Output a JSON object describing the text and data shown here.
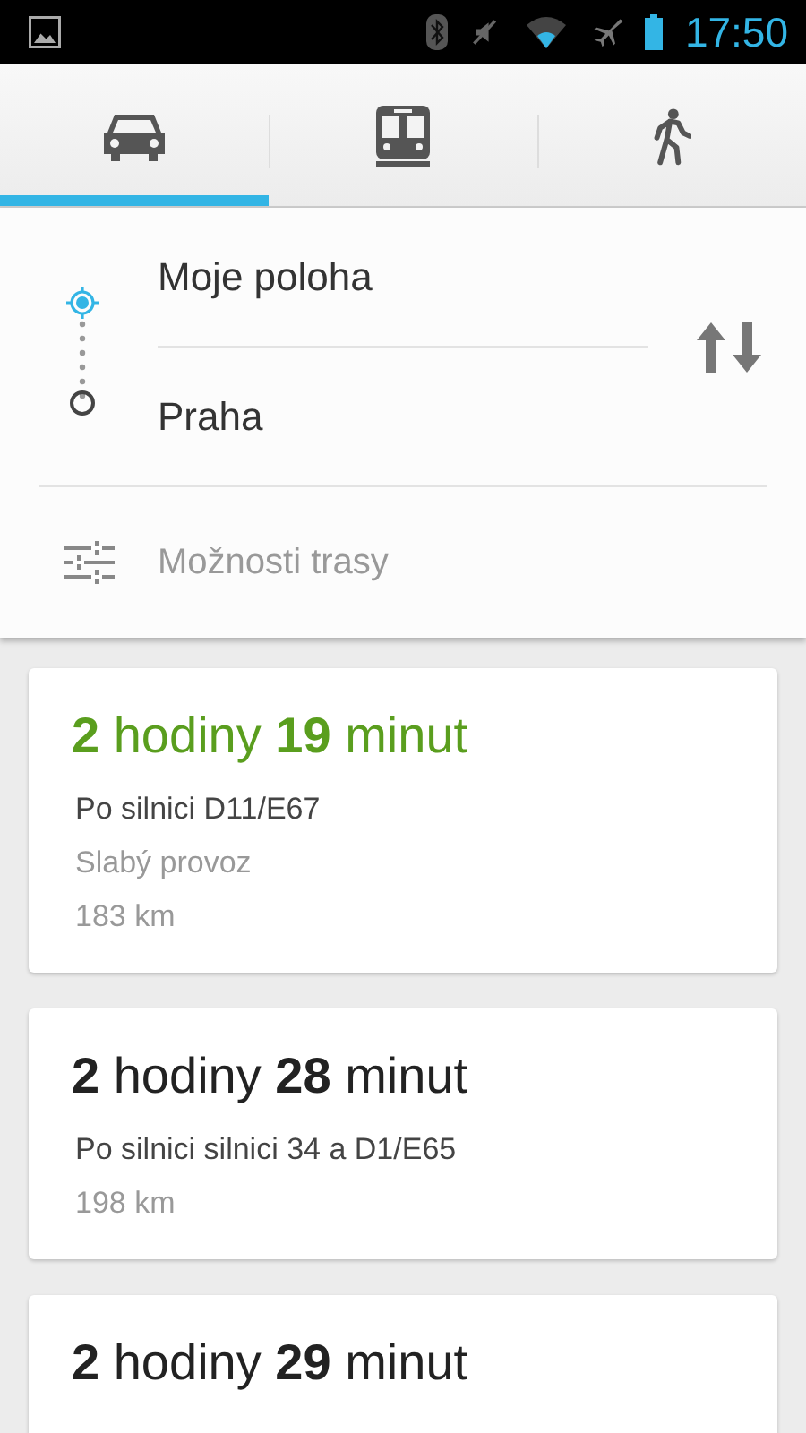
{
  "status_bar": {
    "time": "17:50"
  },
  "tabs": [
    {
      "kind": "car",
      "selected": true
    },
    {
      "kind": "transit",
      "selected": false
    },
    {
      "kind": "walk",
      "selected": false
    }
  ],
  "route_form": {
    "origin": "Moje poloha",
    "destination": "Praha",
    "options_label": "Možnosti trasy"
  },
  "routes": [
    {
      "duration": "**2** hodiny **19** minut",
      "highlighted": true,
      "details": [
        {
          "kind": "via",
          "text": "Po silnici D11/E67"
        },
        {
          "kind": "traffic",
          "text": "Slabý provoz"
        },
        {
          "kind": "distance",
          "text": "183 km"
        }
      ]
    },
    {
      "duration": "**2** hodiny **28** minut",
      "highlighted": false,
      "details": [
        {
          "kind": "via",
          "text": "Po silnici silnici 34 a D1/E65"
        },
        {
          "kind": "distance",
          "text": "198 km"
        }
      ]
    },
    {
      "duration": "**2** hodiny **29** minut",
      "highlighted": false
    }
  ]
}
